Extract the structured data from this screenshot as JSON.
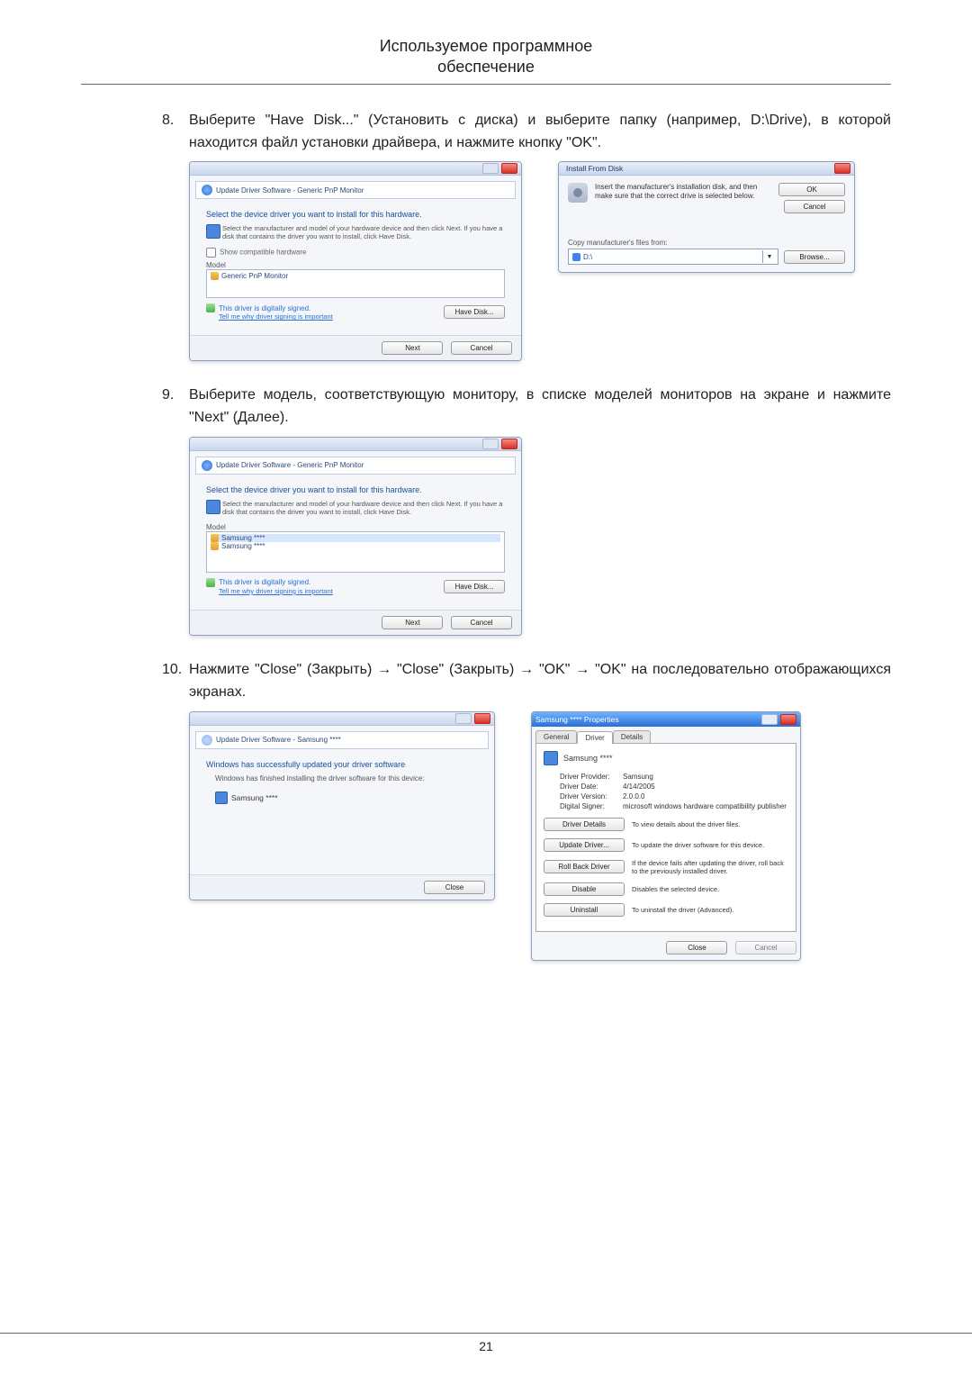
{
  "page": {
    "header_line1": "Используемое программное",
    "header_line2": "обеспечение",
    "number": "21"
  },
  "steps": {
    "s8": {
      "num": "8.",
      "text": "Выберите \"Have Disk...\" (Установить с диска) и выберите папку (например, D:\\Drive), в которой находится файл установки драйвера, и нажмите кнопку \"OK\"."
    },
    "s9": {
      "num": "9.",
      "text": "Выберите модель, соответствующую монитору, в списке моделей мониторов на экране и нажмите \"Next\" (Далее)."
    },
    "s10": {
      "num": "10.",
      "text": "Нажмите \"Close\" (Закрыть) → \"Close\" (Закрыть) → \"OK\" → \"OK\" на последовательно отображающихся экранах."
    }
  },
  "dlg_update": {
    "breadcrumb": "Update Driver Software - Generic PnP Monitor",
    "title": "Select the device driver you want to install for this hardware.",
    "desc": "Select the manufacturer and model of your hardware device and then click Next. If you have a disk that contains the driver you want to install, click Have Disk.",
    "checkbox": "Show compatible hardware",
    "model_label": "Model",
    "model_item": "Generic PnP Monitor",
    "signed": "This driver is digitally signed.",
    "signed_link": "Tell me why driver signing is important",
    "have_disk": "Have Disk...",
    "next": "Next",
    "cancel": "Cancel"
  },
  "dlg_install_from_disk": {
    "title": "Install From Disk",
    "text": "Insert the manufacturer's installation disk, and then make sure that the correct drive is selected below.",
    "ok": "OK",
    "cancel": "Cancel",
    "copy_label": "Copy manufacturer's files from:",
    "combo_value": "D:\\",
    "browse": "Browse..."
  },
  "dlg_update2": {
    "breadcrumb": "Update Driver Software - Generic PnP Monitor",
    "title": "Select the device driver you want to install for this hardware.",
    "desc": "Select the manufacturer and model of your hardware device and then click Next. If you have a disk that contains the driver you want to install, click Have Disk.",
    "model_label": "Model",
    "model_item1": "Samsung ****",
    "model_item2": "Samsung ****",
    "signed": "This driver is digitally signed.",
    "signed_link": "Tell me why driver signing is important",
    "have_disk": "Have Disk...",
    "next": "Next",
    "cancel": "Cancel"
  },
  "dlg_success": {
    "breadcrumb": "Update Driver Software - Samsung ****",
    "title": "Windows has successfully updated your driver software",
    "desc": "Windows has finished installing the driver software for this device:",
    "device": "Samsung ****",
    "close": "Close"
  },
  "dlg_props": {
    "title": "Samsung **** Properties",
    "tab_general": "General",
    "tab_driver": "Driver",
    "tab_details": "Details",
    "device": "Samsung ****",
    "kv": {
      "provider_k": "Driver Provider:",
      "provider_v": "Samsung",
      "date_k": "Driver Date:",
      "date_v": "4/14/2005",
      "version_k": "Driver Version:",
      "version_v": "2.0.0.0",
      "signer_k": "Digital Signer:",
      "signer_v": "microsoft windows hardware compatibility publisher"
    },
    "btn_details": "Driver Details",
    "btn_details_desc": "To view details about the driver files.",
    "btn_update": "Update Driver...",
    "btn_update_desc": "To update the driver software for this device.",
    "btn_rollback": "Roll Back Driver",
    "btn_rollback_desc": "If the device fails after updating the driver, roll back to the previously installed driver.",
    "btn_disable": "Disable",
    "btn_disable_desc": "Disables the selected device.",
    "btn_uninstall": "Uninstall",
    "btn_uninstall_desc": "To uninstall the driver (Advanced).",
    "close": "Close",
    "cancel": "Cancel"
  }
}
